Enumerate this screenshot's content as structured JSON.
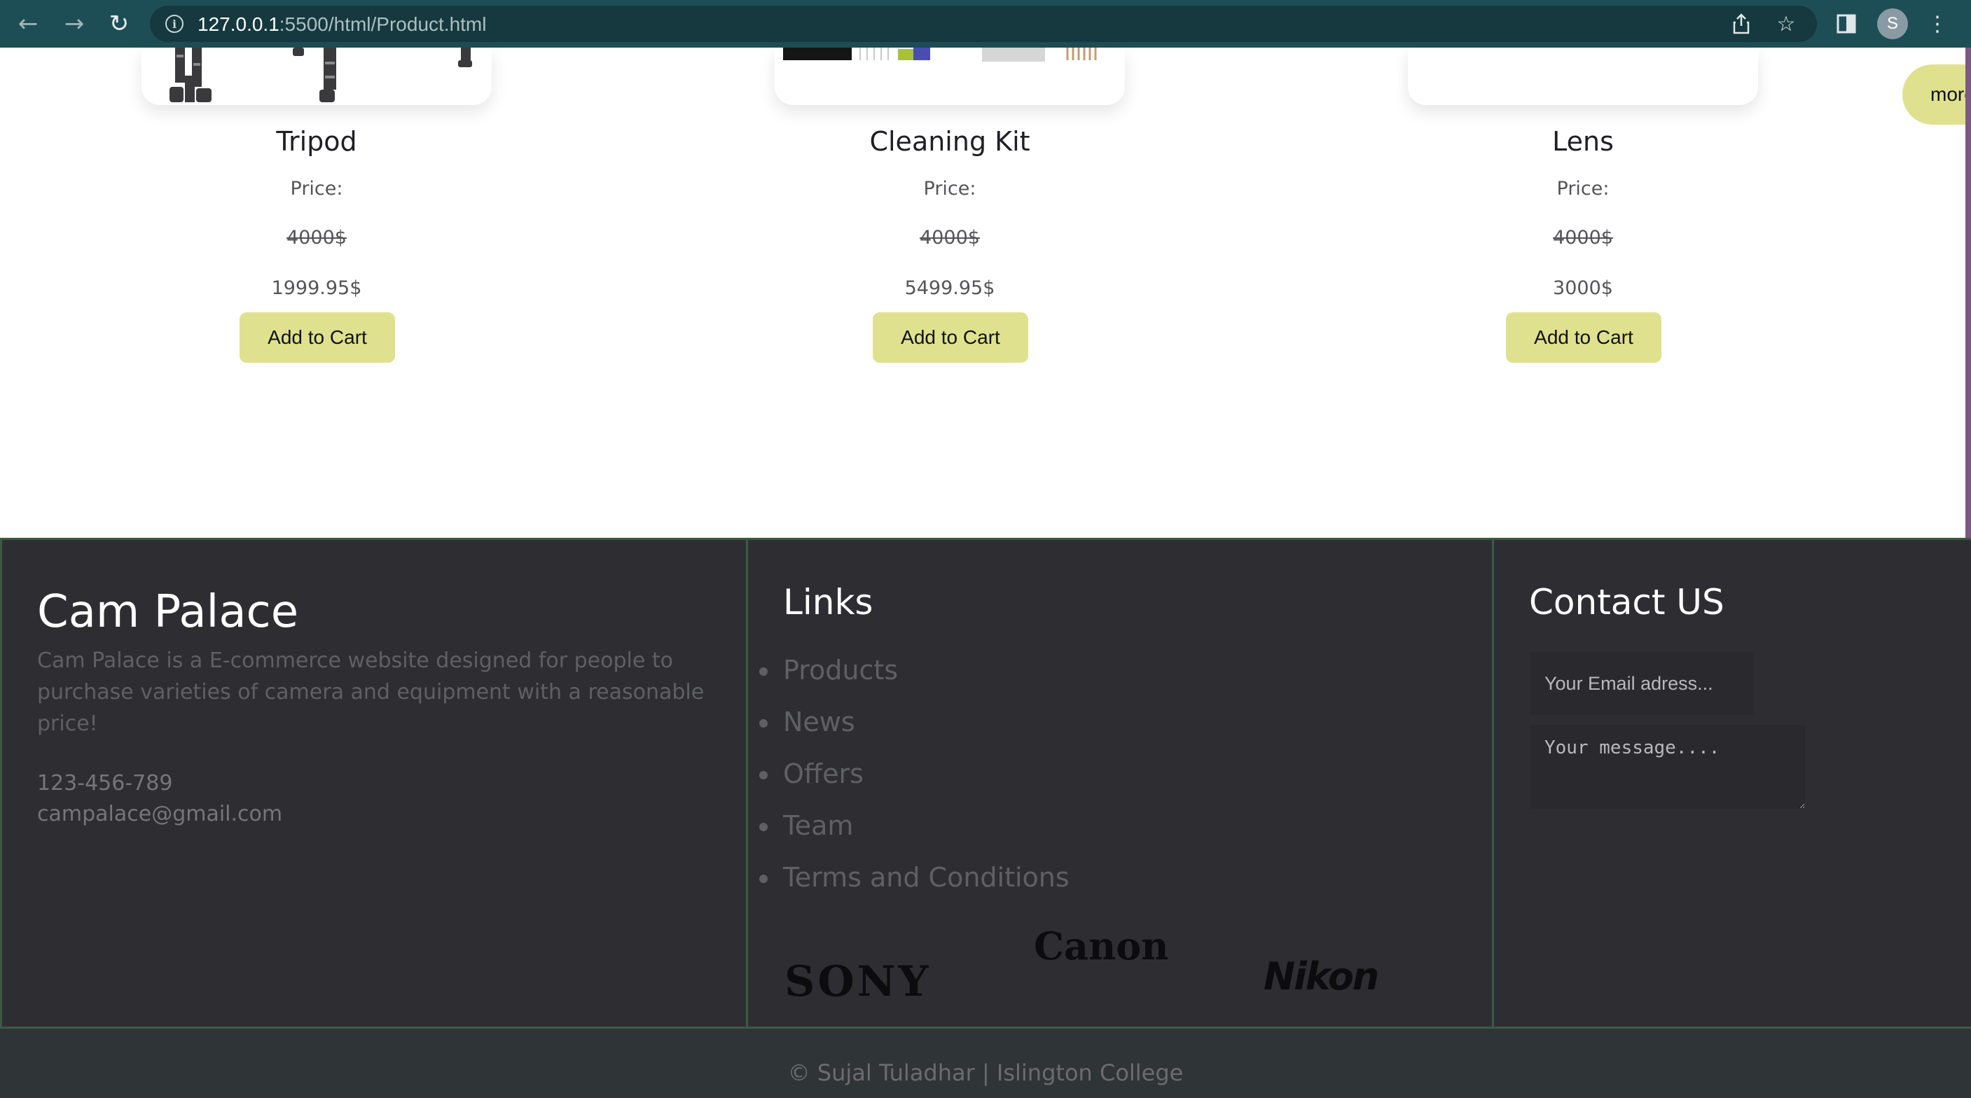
{
  "browser": {
    "url_host": "127.0.0.1",
    "url_path": ":5500/html/Product.html",
    "profile_initial": "S",
    "icons": [
      "back-icon",
      "forward-icon",
      "reload-icon",
      "info-icon",
      "share-icon",
      "star-icon",
      "sidebar-icon",
      "menu-icon"
    ]
  },
  "products": [
    {
      "name": "Tripod",
      "price_label": "Price:",
      "old_price": "4000$",
      "new_price": "1999.95$",
      "button": "Add to Cart"
    },
    {
      "name": "Cleaning Kit",
      "price_label": "Price:",
      "old_price": "4000$",
      "new_price": "5499.95$",
      "button": "Add to Cart"
    },
    {
      "name": "Lens",
      "price_label": "Price:",
      "old_price": "4000$",
      "new_price": "3000$",
      "button": "Add to Cart"
    }
  ],
  "more_button": "more",
  "footer": {
    "brand": "Cam Palace",
    "about": "Cam Palace is a E-commerce website designed for people to purchase varieties of camera and equipment with a reasonable price!",
    "phone": "123-456-789",
    "email": "campalace@gmail.com",
    "links_title": "Links",
    "links": [
      "Products",
      "News",
      "Offers",
      "Team",
      "Terms and Conditions"
    ],
    "logos": [
      "SONY",
      "Canon",
      "Nikon"
    ],
    "contact_title": "Contact US",
    "email_placeholder": "Your Email adress...",
    "message_placeholder": "Your message...."
  },
  "copyright": "© Sujal Tuladhar | Islington College",
  "colors": {
    "chrome": "#1e4e55",
    "button": "#dfe18f",
    "footer_bg": "#2e2e32",
    "border": "#3b5a45"
  }
}
